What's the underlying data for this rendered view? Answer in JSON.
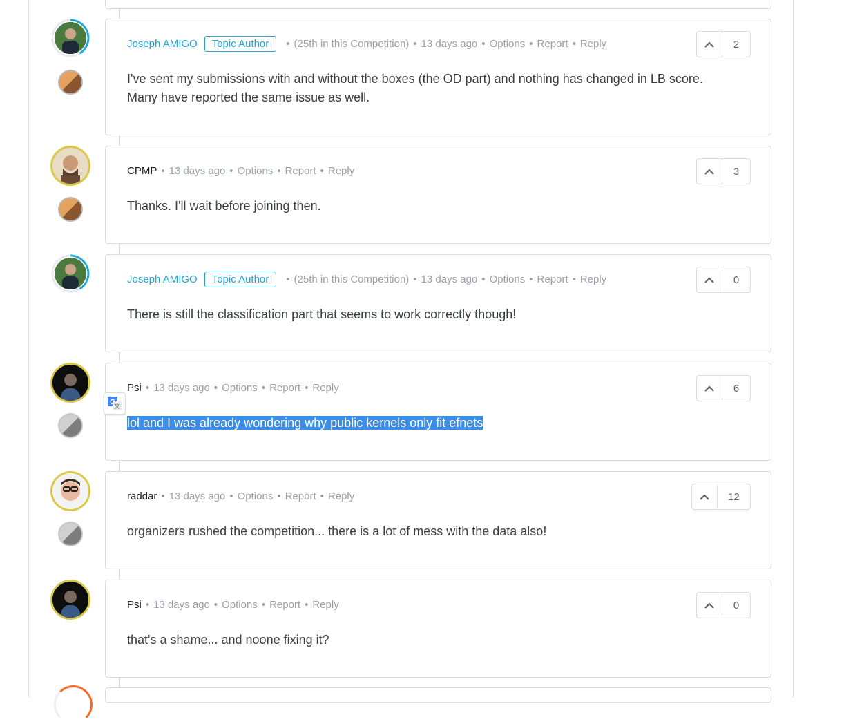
{
  "comments": [
    {
      "author": "Joseph AMIGO",
      "topic_author_badge": "Topic Author",
      "rank_note": "(25th in this Competition)",
      "time": "13 days ago",
      "actions": [
        "Options",
        "Report",
        "Reply"
      ],
      "body_lines": [
        "I've sent my submissions with and without the boxes (the OD part) and nothing has changed in LB score.",
        "Many have reported the same issue as well."
      ],
      "votes": "2",
      "medal": "bronze"
    },
    {
      "author": "CPMP",
      "time": "13 days ago",
      "actions": [
        "Options",
        "Report",
        "Reply"
      ],
      "body_lines": [
        "Thanks. I'll wait before joining then."
      ],
      "votes": "3",
      "medal": "bronze"
    },
    {
      "author": "Joseph AMIGO",
      "topic_author_badge": "Topic Author",
      "rank_note": "(25th in this Competition)",
      "time": "13 days ago",
      "actions": [
        "Options",
        "Report",
        "Reply"
      ],
      "body_lines": [
        "There is still the classification part that seems to work correctly though!"
      ],
      "votes": "0"
    },
    {
      "author": "Psi",
      "time": "13 days ago",
      "actions": [
        "Options",
        "Report",
        "Reply"
      ],
      "body_lines": [
        "lol and I was already wondering why public kernels only fit efnets"
      ],
      "votes": "6",
      "medal": "silver",
      "selected_text": true
    },
    {
      "author": "raddar",
      "time": "13 days ago",
      "actions": [
        "Options",
        "Report",
        "Reply"
      ],
      "body_lines": [
        "organizers rushed the competition... there is a lot of mess with the data also!"
      ],
      "votes": "12",
      "medal": "silver"
    },
    {
      "author": "Psi",
      "time": "13 days ago",
      "actions": [
        "Options",
        "Report",
        "Reply"
      ],
      "body_lines": [
        "that's a shame... and noone fixing it?"
      ],
      "votes": "0"
    }
  ],
  "colors": {
    "author_highlight": "#20a7d8",
    "selection": "#3b8ee8",
    "gold_ring": "#d9c84a",
    "blue_ring": "#20a7d8"
  }
}
